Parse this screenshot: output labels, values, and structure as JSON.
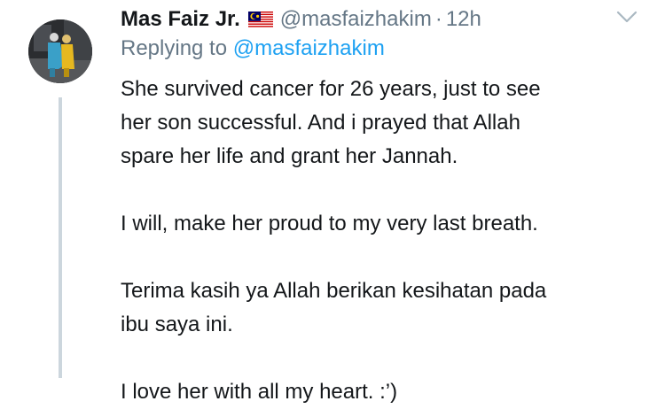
{
  "tweet": {
    "display_name": "Mas Faiz Jr.",
    "flag_icon": "malaysia-flag-icon",
    "handle": "@masfaizhakim",
    "separator": "·",
    "timestamp": "12h",
    "reply_prefix": "Replying to",
    "reply_handle": "@masfaizhakim",
    "paragraphs": [
      "She survived cancer for 26 years, just to see\nher son successful. And i prayed that Allah\nspare her life and grant her Jannah.",
      "I will, make her proud to my very last breath.",
      "Terima kasih ya Allah berikan kesihatan pada\nibu saya ini.",
      "I love her with all my heart. :’)"
    ]
  },
  "colors": {
    "primary_text": "#14171a",
    "secondary_text": "#657786",
    "link": "#1da1f2",
    "thread_line": "#ccd6dd"
  },
  "icons": {
    "more_options": "chevron-down-icon"
  }
}
